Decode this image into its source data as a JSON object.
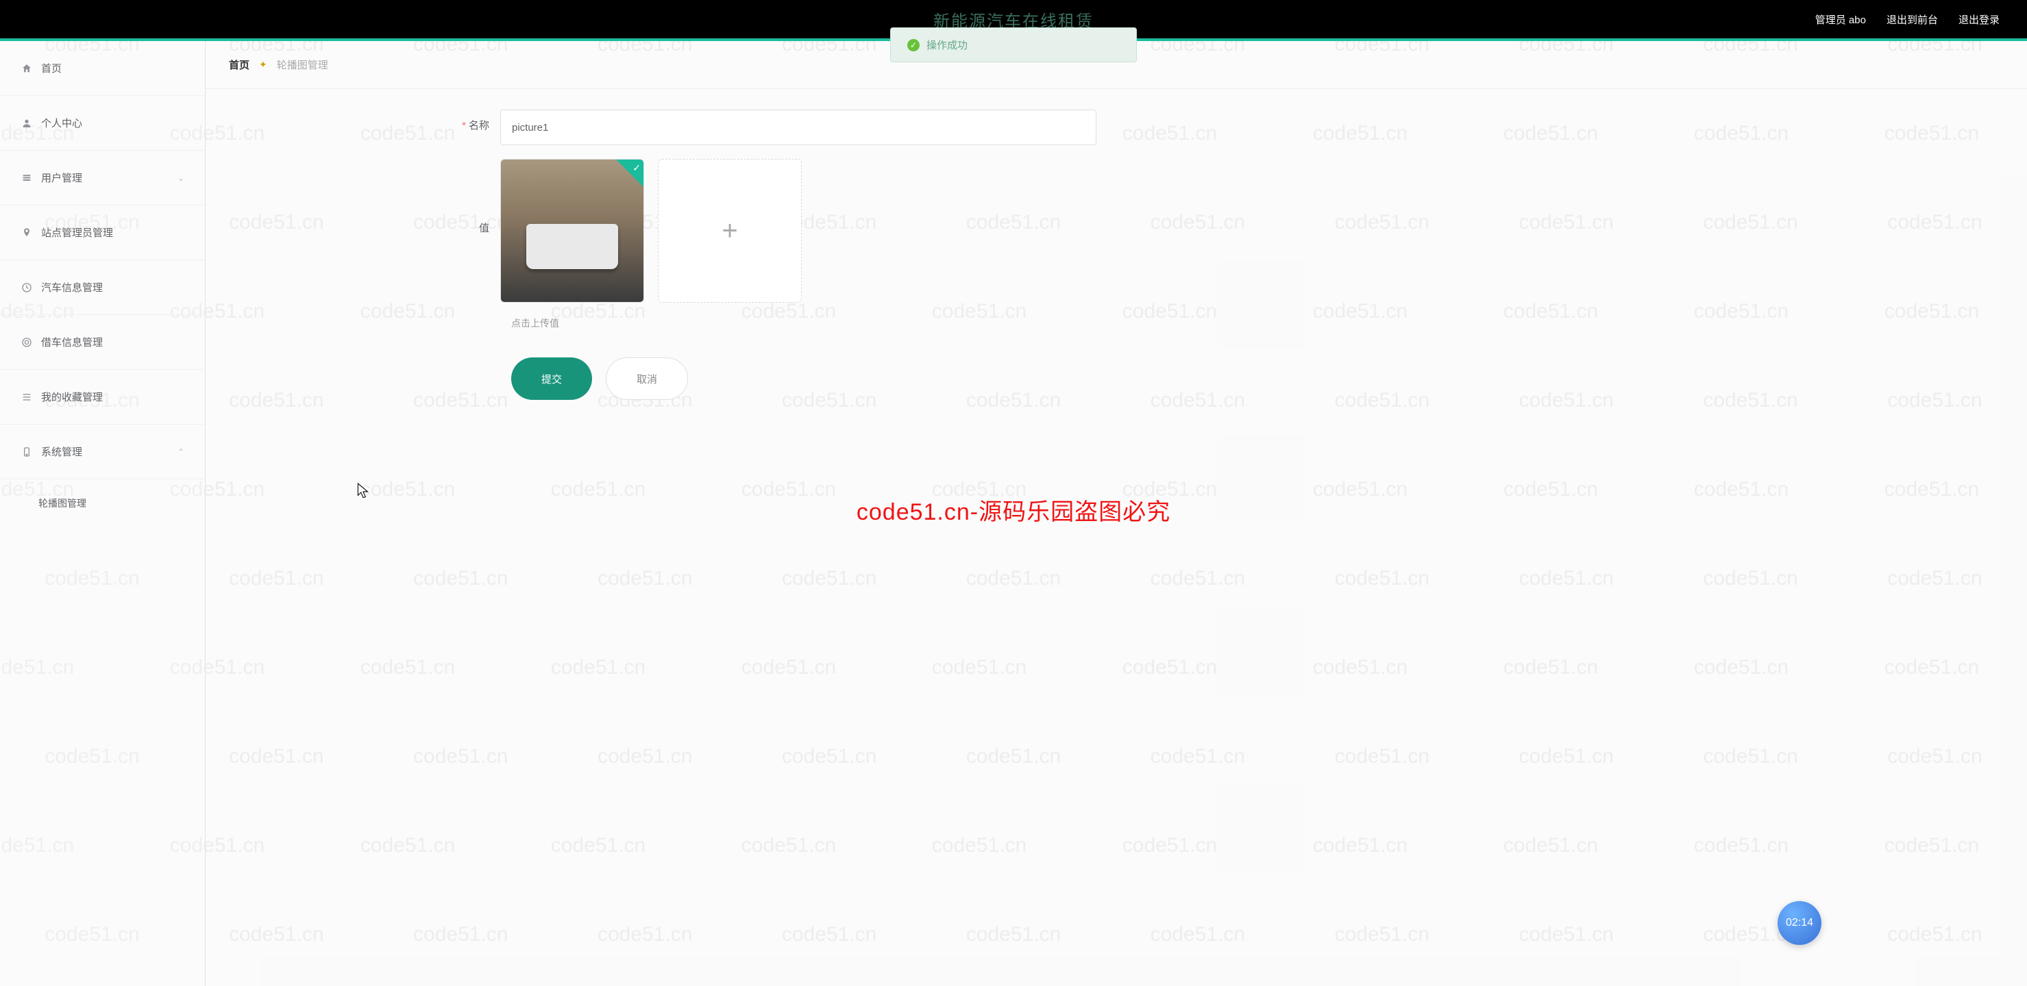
{
  "header": {
    "title_faded": "新能源汽车在线租赁",
    "admin_label": "管理员 abo",
    "exit_front": "退出到前台",
    "logout": "退出登录"
  },
  "toast": {
    "text": "操作成功"
  },
  "sidebar": {
    "items": [
      {
        "icon": "home",
        "label": "首页"
      },
      {
        "icon": "user",
        "label": "个人中心"
      },
      {
        "icon": "users",
        "label": "用户管理",
        "expandable": true,
        "expanded": false
      },
      {
        "icon": "pin",
        "label": "站点管理员管理"
      },
      {
        "icon": "clock",
        "label": "汽车信息管理"
      },
      {
        "icon": "target",
        "label": "借车信息管理"
      },
      {
        "icon": "list",
        "label": "我的收藏管理"
      },
      {
        "icon": "phone",
        "label": "系统管理",
        "expandable": true,
        "expanded": true
      }
    ],
    "sub": [
      {
        "label": "轮播图管理"
      }
    ]
  },
  "breadcrumb": {
    "home": "首页",
    "current": "轮播图管理"
  },
  "form": {
    "name_label": "名称",
    "name_value": "picture1",
    "value_label": "值",
    "hint": "点击上传值",
    "submit": "提交",
    "cancel": "取消"
  },
  "watermark_text": "code51.cn",
  "red_watermark": "code51.cn-源码乐园盗图必究",
  "float_badge": "02:14"
}
